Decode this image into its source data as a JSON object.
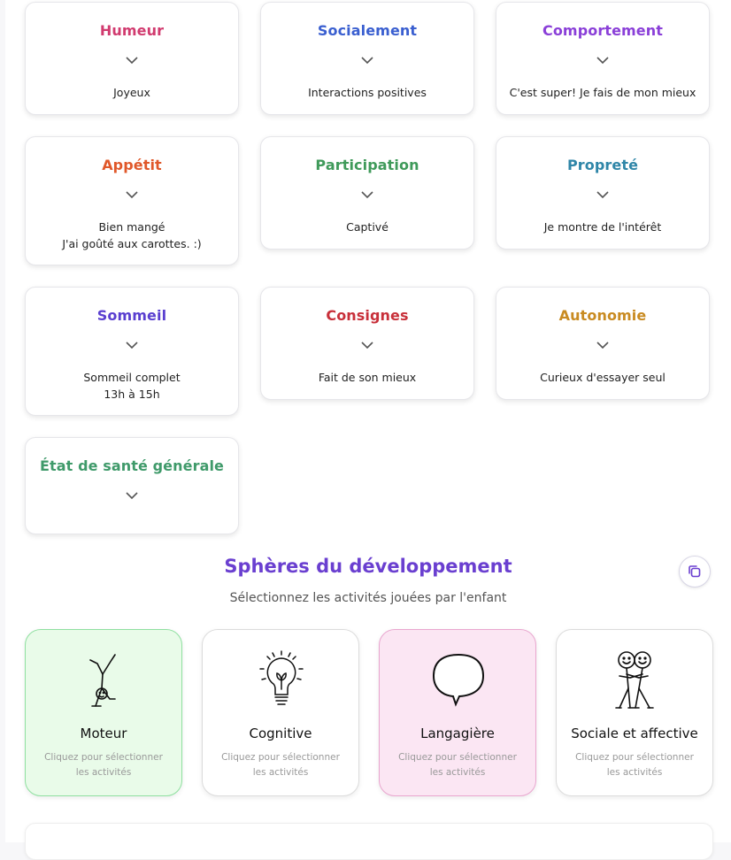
{
  "cards": [
    {
      "title": "Humeur",
      "color": "#d13b6f",
      "value": "Joyeux"
    },
    {
      "title": "Socialement",
      "color": "#3a5fd0",
      "value": "Interactions positives"
    },
    {
      "title": "Comportement",
      "color": "#8a3fd8",
      "value": "C'est super! Je fais de mon mieux"
    },
    {
      "title": "Appétit",
      "color": "#e0582a",
      "value": "Bien mangé\nJ'ai goûté aux carottes. :)"
    },
    {
      "title": "Participation",
      "color": "#3f9a5a",
      "value": "Captivé"
    },
    {
      "title": "Propreté",
      "color": "#2f86a8",
      "value": "Je montre de l'intérêt"
    },
    {
      "title": "Sommeil",
      "color": "#5a3fd0",
      "value": "Sommeil complet\n13h à 15h"
    },
    {
      "title": "Consignes",
      "color": "#c8303a",
      "value": "Fait de son mieux"
    },
    {
      "title": "Autonomie",
      "color": "#c98b22",
      "value": "Curieux d'essayer seul"
    },
    {
      "title": "État de santé générale",
      "color": "#3f9a6a",
      "value": ""
    }
  ],
  "section": {
    "title": "Sphères du développement",
    "subtitle": "Sélectionnez les activités jouées par l'enfant"
  },
  "spheres": [
    {
      "name": "Moteur",
      "hint": "Cliquez pour sélectionner les activités",
      "icon": "handstand-icon",
      "bg": "#e9fbe9",
      "border": "#8fe0a0"
    },
    {
      "name": "Cognitive",
      "hint": "Cliquez pour sélectionner les activités",
      "icon": "lightbulb-icon",
      "bg": "#ffffff",
      "border": "#dcdcdc"
    },
    {
      "name": "Langagière",
      "hint": "Cliquez pour sélectionner les activités",
      "icon": "speech-bubble-icon",
      "bg": "#fbe6f3",
      "border": "#e9a6cf"
    },
    {
      "name": "Sociale et affective",
      "hint": "Cliquez pour sélectionner les activités",
      "icon": "friends-hugging-icon",
      "bg": "#ffffff",
      "border": "#dcdcdc"
    }
  ]
}
